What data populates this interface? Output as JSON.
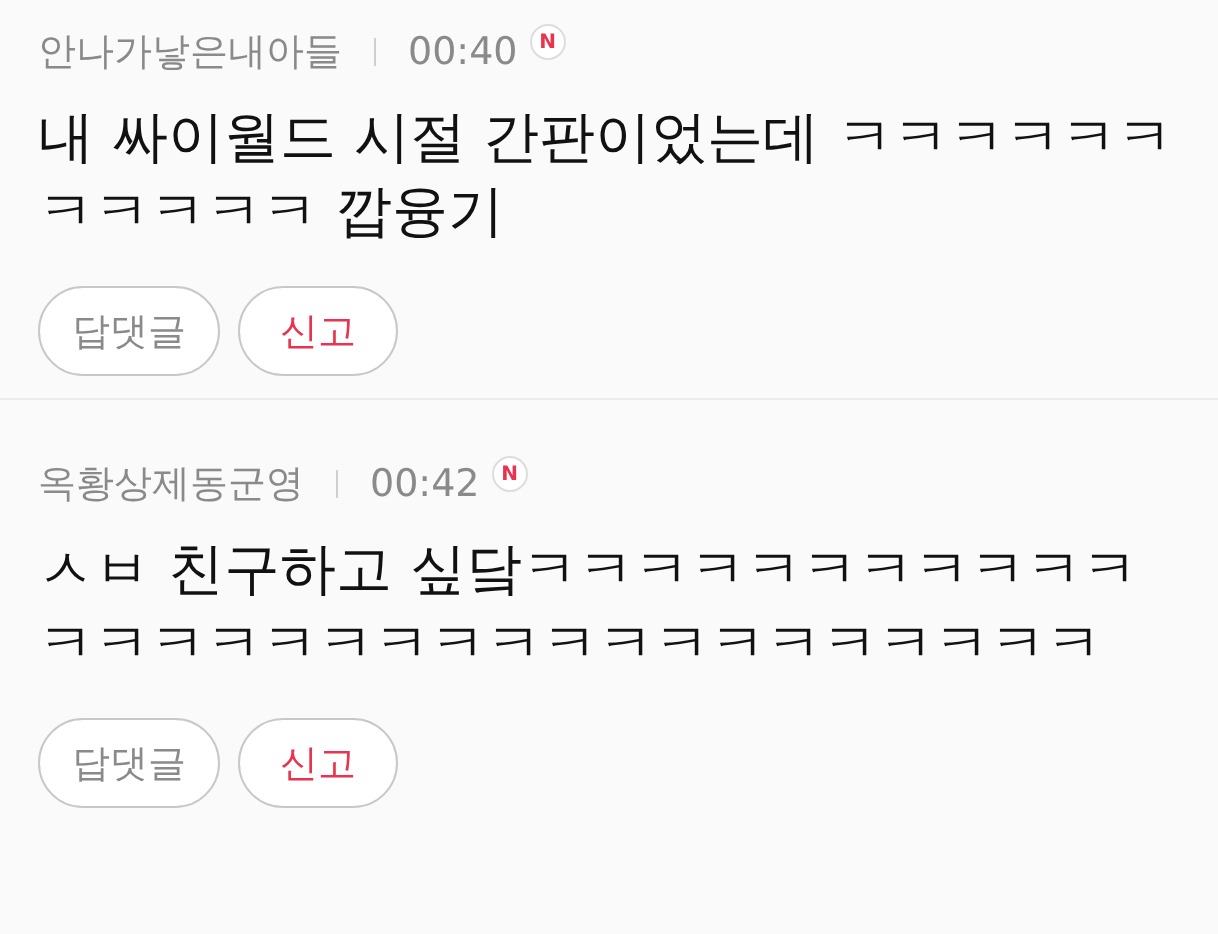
{
  "comments": [
    {
      "author": "안나가낳은내아들",
      "time": "00:40",
      "new_badge": "N",
      "text": "내 싸이월드 시절 간판이었는데 ㅋㅋㅋㅋㅋㅋㅋㅋㅋㅋㅋ 깝융기",
      "buttons": [
        {
          "label": "답댓글",
          "kind": "reply"
        },
        {
          "label": "신고",
          "kind": "report"
        }
      ]
    },
    {
      "author": "옥황상제동군영",
      "time": "00:42",
      "new_badge": "N",
      "text": "ㅅㅂ 친구하고 싶닼ㅋㅋㅋㅋㅋㅋㅋㅋㅋㅋㅋㅋㅋㅋㅋㅋㅋㅋㅋㅋㅋㅋㅋㅋㅋㅋㅋㅋㅋㅋ",
      "buttons": [
        {
          "label": "답댓글",
          "kind": "reply"
        },
        {
          "label": "신고",
          "kind": "report"
        }
      ]
    }
  ]
}
